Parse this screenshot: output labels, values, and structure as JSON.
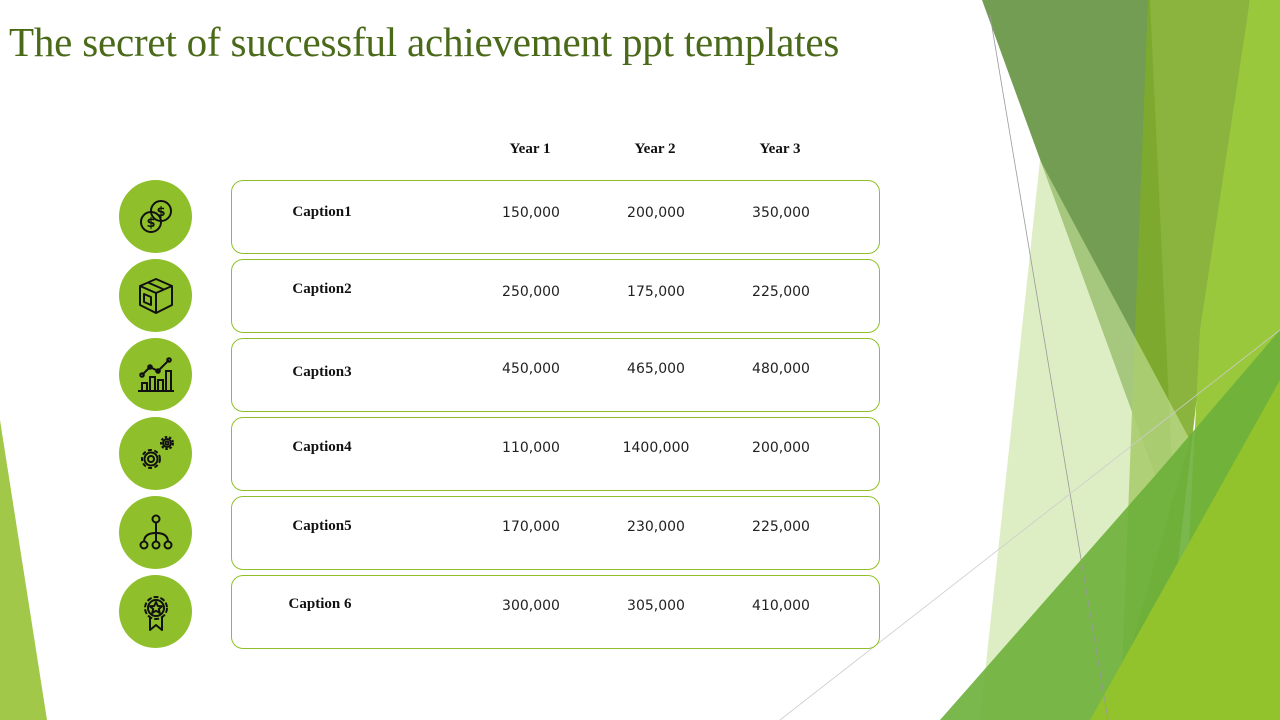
{
  "slide": {
    "title": "The secret of successful achievement ppt templates",
    "accent_color": "#8fc02c",
    "title_color": "#4a6a1a"
  },
  "table": {
    "columns": [
      "Year 1",
      "Year 2",
      "Year 3"
    ],
    "rows": [
      {
        "icon": "coins-dollar-icon",
        "caption": "Caption1",
        "values": [
          "150,000",
          "200,000",
          "350,000"
        ]
      },
      {
        "icon": "package-box-icon",
        "caption": "Caption2",
        "values": [
          "250,000",
          "175,000",
          "225,000"
        ]
      },
      {
        "icon": "growth-chart-icon",
        "caption": "Caption3",
        "values": [
          "450,000",
          "465,000",
          "480,000"
        ]
      },
      {
        "icon": "gears-icon",
        "caption": "Caption4",
        "values": [
          "110,000",
          "1400,000",
          "200,000"
        ]
      },
      {
        "icon": "hierarchy-network-icon",
        "caption": "Caption5",
        "values": [
          "170,000",
          "230,000",
          "225,000"
        ]
      },
      {
        "icon": "award-badge-icon",
        "caption": "Caption 6",
        "values": [
          "300,000",
          "305,000",
          "410,000"
        ]
      }
    ]
  }
}
